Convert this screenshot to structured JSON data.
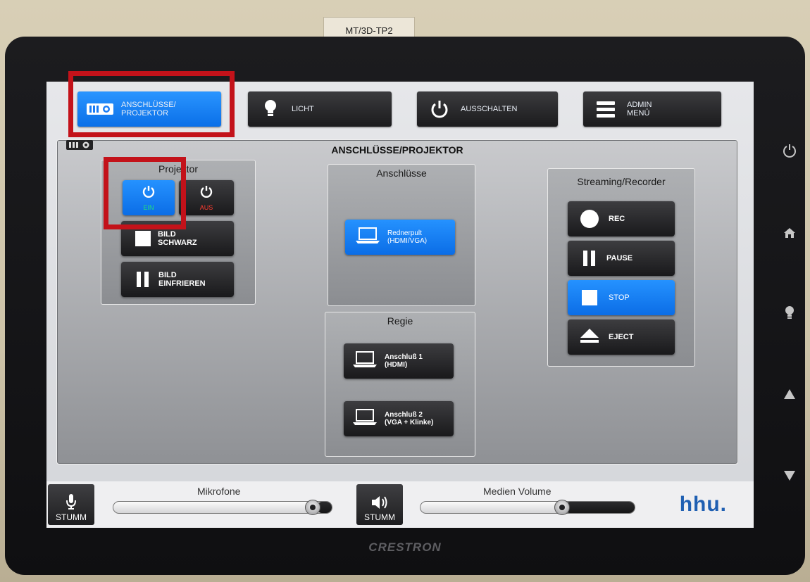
{
  "device_label": "MT/3D-TP2",
  "brand_logo": "hhu.",
  "hardware_brand": "CRESTRON",
  "top_nav": [
    {
      "label": "ANSCHLÜSSE/\nPROJEKTOR",
      "icon": "projector-icon",
      "active": true
    },
    {
      "label": "LICHT",
      "icon": "bulb-icon",
      "active": false
    },
    {
      "label": "AUSSCHALTEN",
      "icon": "power-icon",
      "active": false
    },
    {
      "label": "ADMIN\nMENÜ",
      "icon": "menu-icon",
      "active": false
    }
  ],
  "panel_title": "ANSCHLÜSSE/PROJEKTOR",
  "projektor": {
    "title": "Projektor",
    "ein": "EIN",
    "aus": "AUS",
    "bild_schwarz": "BILD\nSCHWARZ",
    "bild_einfrieren": "BILD\nEINFRIEREN"
  },
  "anschluesse": {
    "title": "Anschlüsse",
    "rednerpult": "Rednerpult\n(HDMI/VGA)"
  },
  "regie": {
    "title": "Regie",
    "anschluss1": "Anschluß 1\n(HDMI)",
    "anschluss2": "Anschluß 2\n(VGA + Klinke)"
  },
  "streaming": {
    "title": "Streaming/Recorder",
    "rec": "REC",
    "pause": "PAUSE",
    "stop": "STOP",
    "eject": "EJECT"
  },
  "bottom": {
    "mikrofone_label": "Mikrofone",
    "medien_label": "Medien Volume",
    "stumm_label": "STUMM",
    "mikrofone_level": 0.95,
    "medien_level": 0.67
  },
  "colors": {
    "accent_blue": "#0b6de6",
    "highlight_red": "#c3121a",
    "aus_red": "#ff3b30"
  }
}
